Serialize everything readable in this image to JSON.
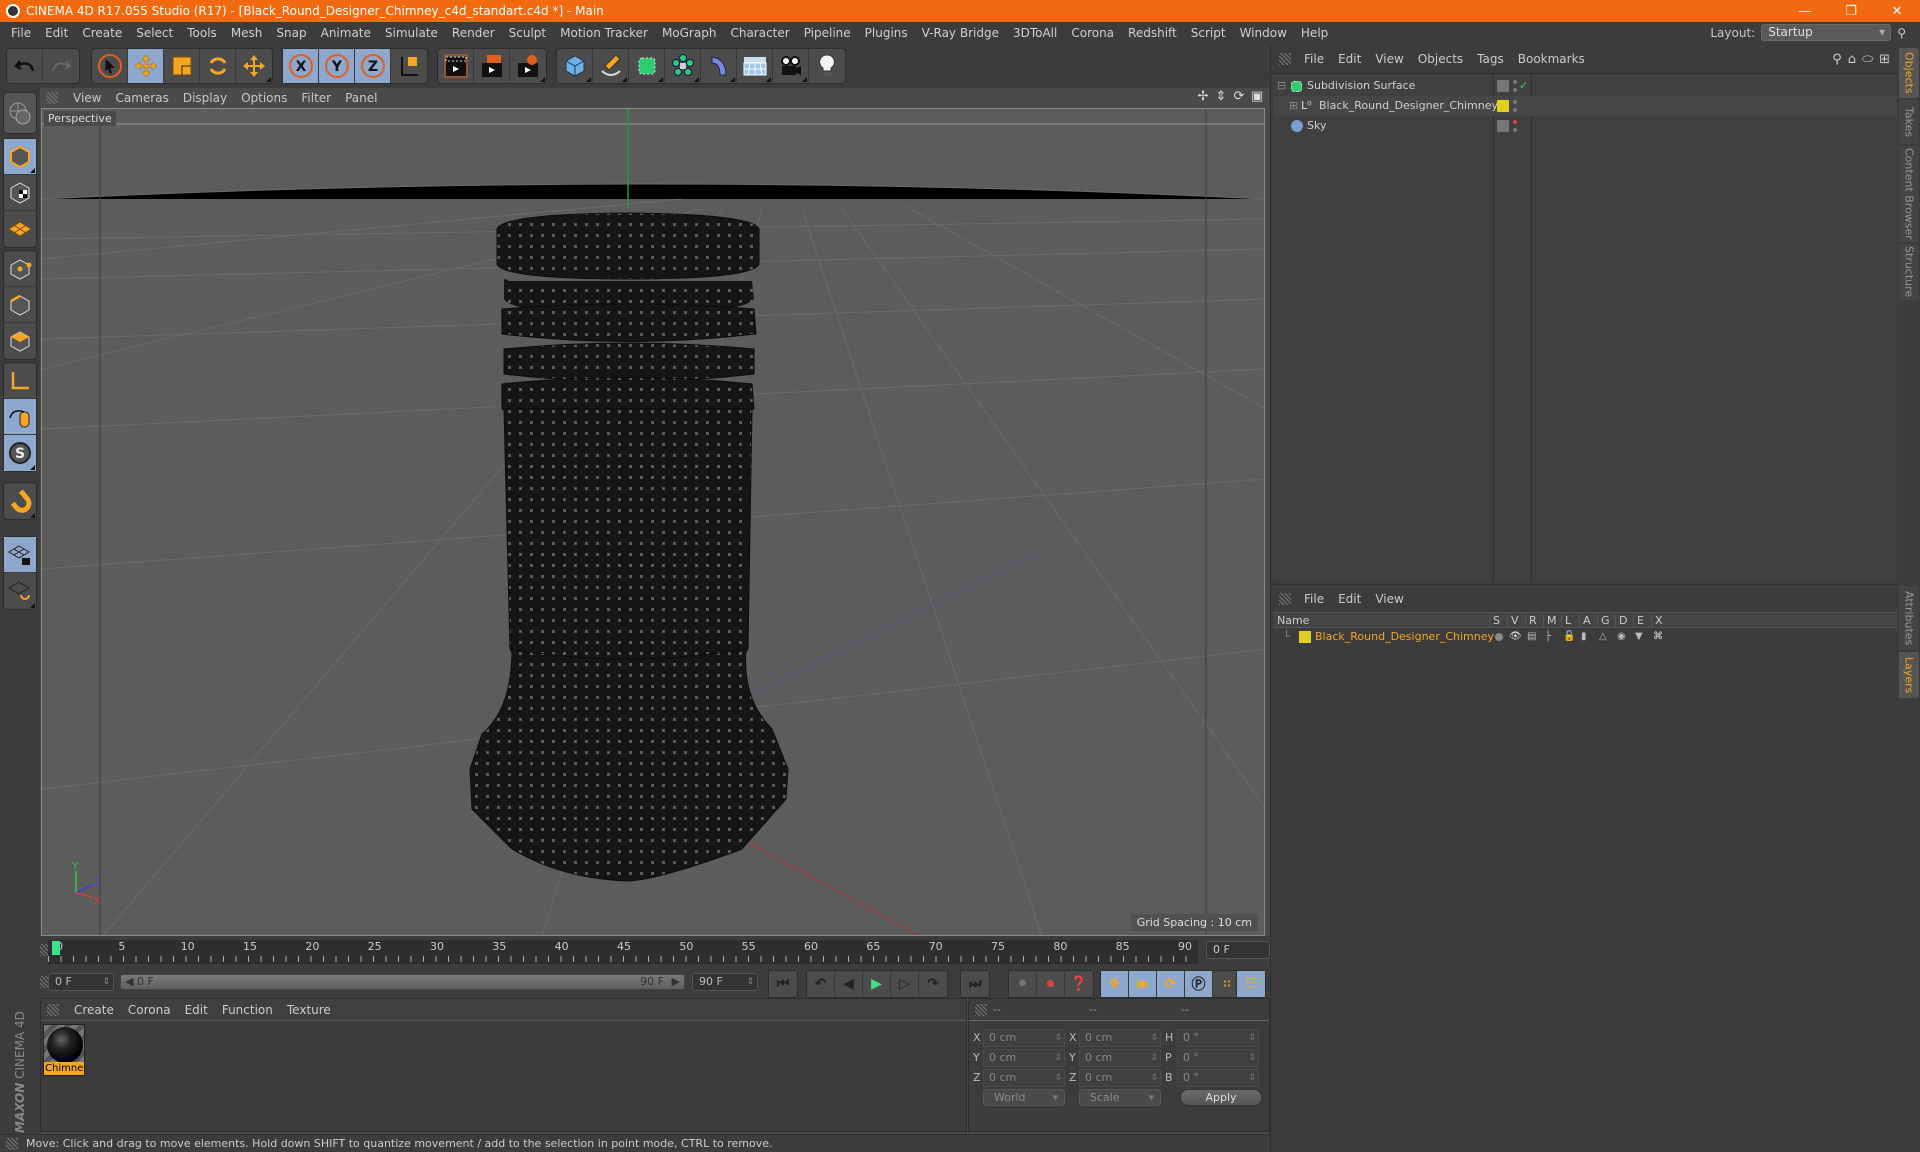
{
  "window": {
    "title": "CINEMA 4D R17.055 Studio (R17) - [Black_Round_Designer_Chimney_c4d_standart.c4d *] - Main",
    "controls": [
      "minimize",
      "restore",
      "close"
    ]
  },
  "menubar": {
    "items": [
      "File",
      "Edit",
      "Create",
      "Select",
      "Tools",
      "Mesh",
      "Snap",
      "Animate",
      "Simulate",
      "Render",
      "Sculpt",
      "Motion Tracker",
      "MoGraph",
      "Character",
      "Pipeline",
      "Plugins",
      "V-Ray Bridge",
      "3DToAll",
      "Corona",
      "Redshift",
      "Script",
      "Window",
      "Help"
    ],
    "layout_label": "Layout:",
    "layout_value": "Startup"
  },
  "toolbar": {
    "groups": [
      [
        "undo",
        "redo"
      ],
      [
        "select",
        "move",
        "scale",
        "rotate",
        "move-alt"
      ],
      [
        "x-axis",
        "y-axis",
        "z-axis",
        "coordinate-system"
      ],
      [
        "render-view",
        "render-picture-viewer",
        "render-settings"
      ],
      [
        "cube",
        "pen",
        "subdivision",
        "cloner",
        "deformer",
        "floor",
        "camera",
        "light"
      ]
    ]
  },
  "left_tools": [
    "model-mode",
    "texture-mode",
    "workplane-mode",
    "points-mode",
    "edges-mode",
    "polygons-mode",
    "axis-mode",
    "tweak-mode",
    "snap",
    "magnet",
    "lock-workplane",
    "workplane-align"
  ],
  "viewport": {
    "menu": [
      "View",
      "Cameras",
      "Display",
      "Options",
      "Filter",
      "Panel"
    ],
    "label": "Perspective",
    "grid_spacing": "Grid Spacing : 10 cm",
    "axis_labels": {
      "x": "X",
      "y": "Y",
      "z": "Z"
    }
  },
  "timeline": {
    "ticks": [
      "0",
      "5",
      "10",
      "15",
      "20",
      "25",
      "30",
      "35",
      "40",
      "45",
      "50",
      "55",
      "60",
      "65",
      "70",
      "75",
      "80",
      "85",
      "90"
    ],
    "current_frame": "0 F",
    "start_field": "0 F",
    "range_start": "0 F",
    "range_end": "90 F",
    "end_field": "90 F",
    "playhead_frame": 0
  },
  "materials": {
    "menu": [
      "Create",
      "Corona",
      "Edit",
      "Function",
      "Texture"
    ],
    "items": [
      {
        "name": "Chimney",
        "selected": true
      }
    ]
  },
  "coordinates": {
    "headers": [
      "--",
      "--",
      "--"
    ],
    "rows": [
      {
        "l1": "X",
        "v1": "0 cm",
        "l2": "X",
        "v2": "0 cm",
        "l3": "H",
        "v3": "0 °"
      },
      {
        "l1": "Y",
        "v1": "0 cm",
        "l2": "Y",
        "v2": "0 cm",
        "l3": "P",
        "v3": "0 °"
      },
      {
        "l1": "Z",
        "v1": "0 cm",
        "l2": "Z",
        "v2": "0 cm",
        "l3": "B",
        "v3": "0 °"
      }
    ],
    "mode_dropdown": "World",
    "size_dropdown": "Scale",
    "apply_label": "Apply"
  },
  "status": {
    "text": "Move: Click and drag to move elements. Hold down SHIFT to quantize movement / add to the selection in point mode, CTRL to remove."
  },
  "brand": {
    "maxon": "MAXON",
    "product": "CINEMA 4D"
  },
  "object_manager": {
    "menu": [
      "File",
      "Edit",
      "View",
      "Objects",
      "Tags",
      "Bookmarks"
    ],
    "objects": [
      {
        "name": "Subdivision Surface",
        "icon": "subdivision-icon",
        "color": "#2ecc71",
        "check": "✓"
      },
      {
        "name": "Black_Round_Designer_Chimney",
        "icon": "null-object-icon",
        "color": "#e0d020"
      },
      {
        "name": "Sky",
        "icon": "sky-icon",
        "color": "#7aa0d0"
      }
    ]
  },
  "layer_manager": {
    "menu": [
      "File",
      "Edit",
      "View"
    ],
    "columns": [
      "Name",
      "S",
      "V",
      "R",
      "M",
      "L",
      "A",
      "G",
      "D",
      "E",
      "X"
    ],
    "layers": [
      {
        "name": "Black_Round_Designer_Chimney",
        "color": "#e0d020"
      }
    ]
  },
  "side_tabs": {
    "top": [
      {
        "label": "Objects",
        "active": true
      },
      {
        "label": "Takes",
        "active": false
      },
      {
        "label": "Content Browser",
        "active": false
      },
      {
        "label": "Structure",
        "active": false
      }
    ],
    "bottom": [
      {
        "label": "Attributes",
        "active": false
      },
      {
        "label": "Layers",
        "active": true
      }
    ]
  }
}
